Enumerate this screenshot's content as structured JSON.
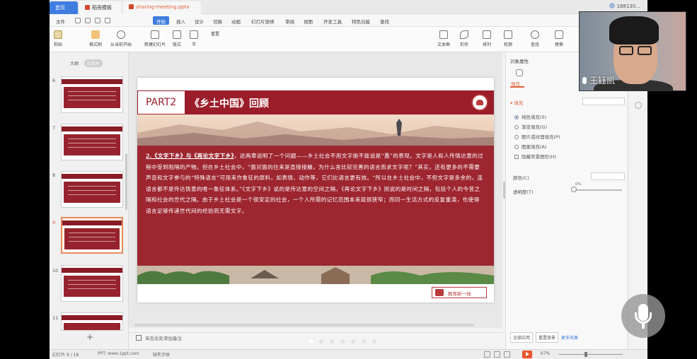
{
  "titlebar": {
    "tabs": [
      {
        "label": "首页"
      },
      {
        "label": "稻壳模板"
      },
      {
        "label": "sharing-meeting.pptx"
      }
    ],
    "user": "188130..."
  },
  "menu": {
    "file_label": "文件",
    "items": [
      "开始",
      "插入",
      "设计",
      "切换",
      "动画",
      "幻灯片放映",
      "审阅",
      "视图",
      "开发工具",
      "特色功能",
      "查找"
    ]
  },
  "ribbon": {
    "tools": [
      "粘贴",
      "格式刷",
      "从当前开始",
      "新建幻灯片",
      "版式",
      "节",
      "重置",
      "文本框",
      "形状",
      "排列",
      "轮廓",
      "查找",
      "替换"
    ]
  },
  "left_panel": {
    "tabs": [
      "大纲",
      "幻灯片"
    ],
    "thumb_numbers": [
      "6",
      "7",
      "8",
      "9",
      "10",
      "11"
    ],
    "selected_thumb": "9"
  },
  "slide": {
    "part": "PART2",
    "title": "《乡土中国》回顾",
    "text_underlined": "2.《文字下乡》与《再论文字下乡》",
    "text_body": "，这两章说明了一个问题——乡土社会不用文字绝不能说是“愚”的表现。文字是人和人传情达意的过程中受到阻隔的产物。但在乡土社会中，“面对面的往来是直接接触，为什么舍比较完善的语言而求文字呢？”其实，还有更多的不需要声音和文字参与的“特殊语言”可用来作象征的原料，如表情、动作等，它们比语言更有效。“所以在乡土社会中，不但文字是多余的，连语言都不是传达情意的唯一象征体系。”《文字下乡》说的是传达意的空间之隔，《再论文字下乡》则说的是时间之隔，包括个人的今昔之隔和社会的世代之隔。由于乡土社会是一个很安定的社会，一个人所需的记忆范围本来就很狭窄；而同一生活方式的反复重演，也使得语言足够传递世代间的经验而无需文字。",
    "footer_logo": "教育新一线"
  },
  "notes_placeholder": "单击此处添加备注",
  "right_panel": {
    "header": "对象属性",
    "tab_label": "填充",
    "section": "填充",
    "options": [
      {
        "label": "纯色填充(S)",
        "type": "radio",
        "checked": true
      },
      {
        "label": "渐变填充(G)",
        "type": "radio",
        "checked": false
      },
      {
        "label": "图片或纹理填充(P)",
        "type": "radio",
        "checked": false
      },
      {
        "label": "图案填充(A)",
        "type": "radio",
        "checked": false
      },
      {
        "label": "隐藏背景图形(H)",
        "type": "checkbox",
        "checked": false
      }
    ],
    "color_label": "颜色(C)",
    "transparency_label": "透明度(T)",
    "transparency_value": "0%",
    "bottom_buttons": [
      "全部应用",
      "重置背景"
    ],
    "bottom_link": "更多效果"
  },
  "statusbar": {
    "slide_counter": "幻灯片 9 / 18",
    "theme": "PPT: www.1ppt.com",
    "spell": "缺失字体",
    "zoom": "67%"
  },
  "webcam": {
    "name": "王钰凯"
  }
}
